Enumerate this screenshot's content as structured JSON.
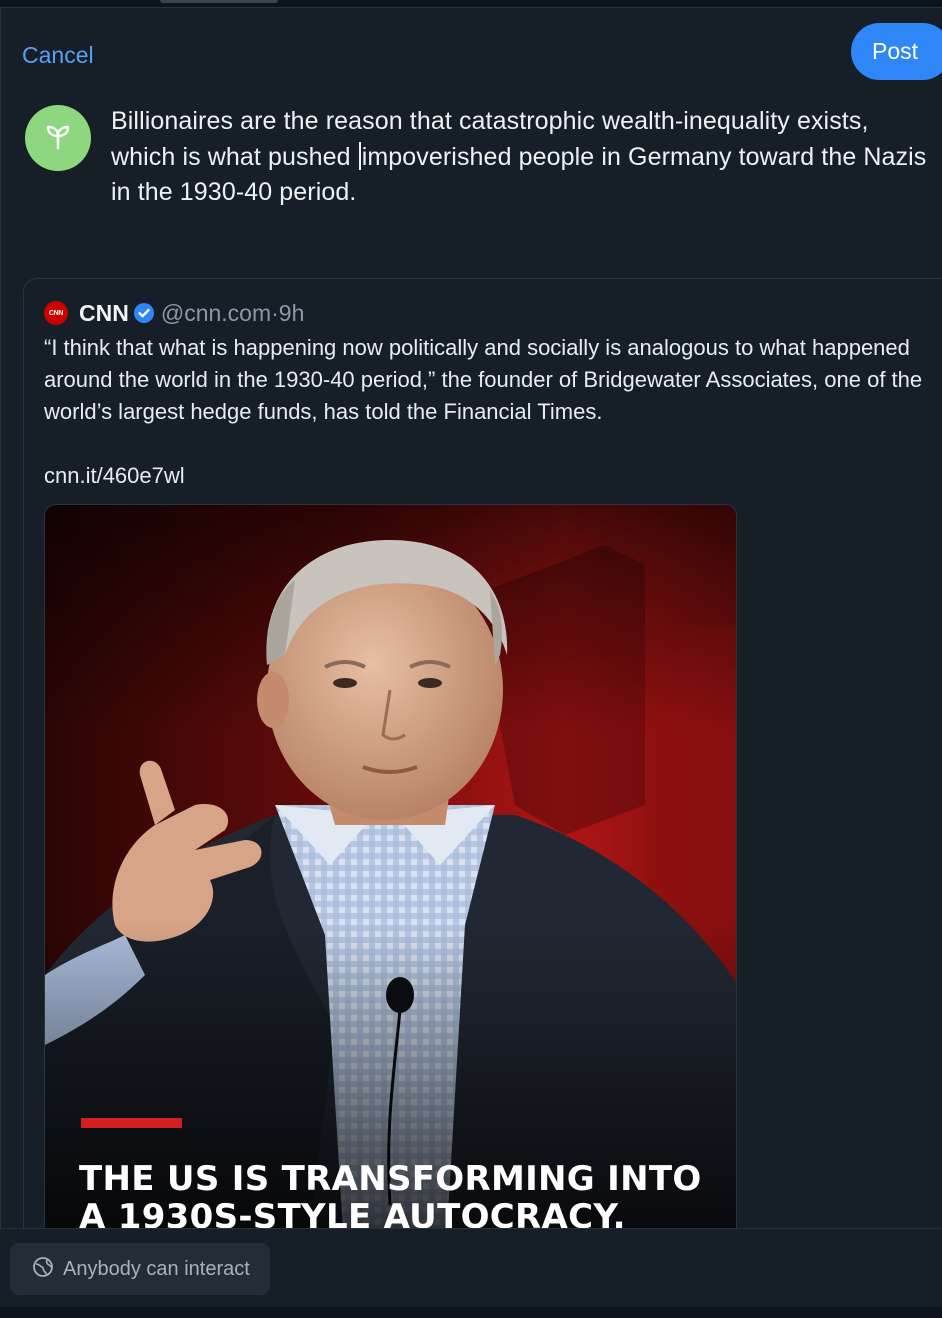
{
  "toolbar": {
    "cancel_label": "Cancel",
    "post_label": "Post"
  },
  "composer": {
    "text_before_caret": "Billionaires are the reason that catastrophic wealth-inequality exists, which is what pushed ",
    "text_after_caret": "impoverished people in Germany toward the Nazis in the 1930-40 period.",
    "avatar_icon": "sprout-icon"
  },
  "quote": {
    "logo_text": "CNN",
    "author_name": "CNN",
    "verified_icon": "verified-check-icon",
    "handle": "@cnn.com",
    "separator": " · ",
    "time": "9h",
    "text": "“I think that what is happening now politically and socially is analogous to what happened around the world in the 1930-40 period,” the founder of Bridgewater Associates, one of the world’s largest hedge funds, has told the Financial Times.",
    "link": "cnn.it/460e7wl",
    "media": {
      "headline": "THE US IS TRANSFORMING INTO A 1930S-STYLE AUTOCRACY."
    }
  },
  "footer": {
    "interaction_label": "Anybody can interact",
    "interaction_icon": "globe-interact-icon"
  },
  "colors": {
    "background": "#161e27",
    "accent": "#2f86f6",
    "link": "#5b9ff2",
    "avatar": "#8fd77f",
    "cnn_red": "#cc0000"
  }
}
